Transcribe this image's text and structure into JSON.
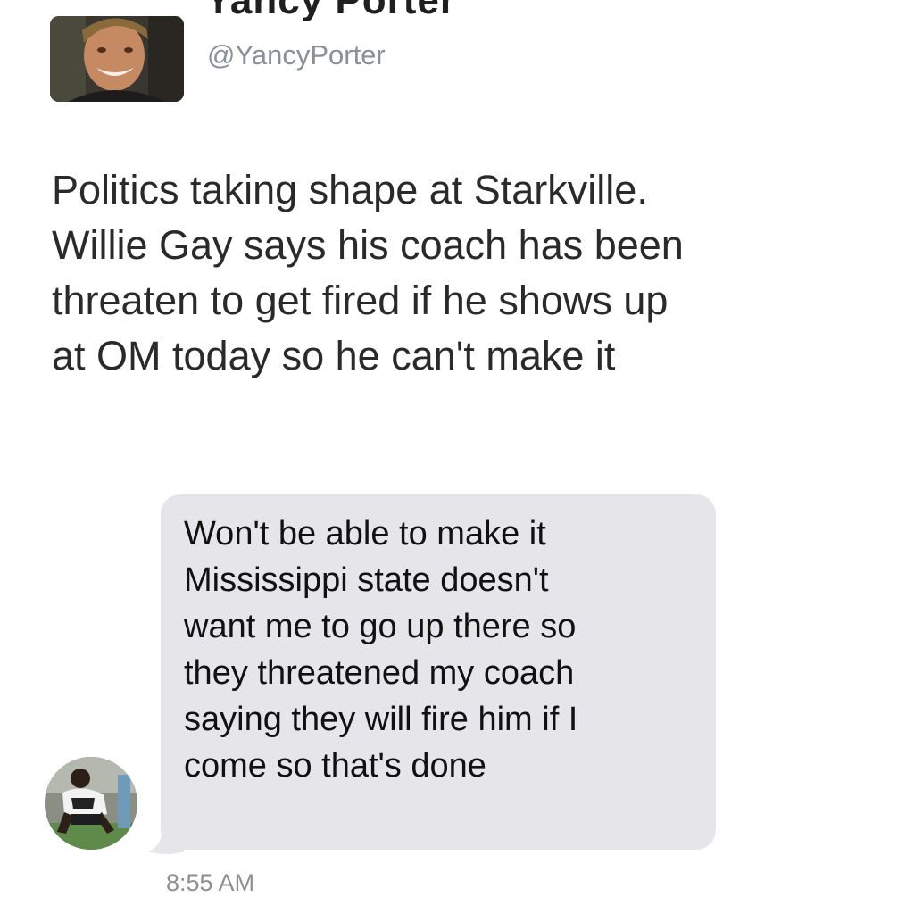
{
  "tweet": {
    "author": {
      "display_name": "Yancy Porter",
      "handle": "@YancyPorter",
      "avatar_icon": "profile-photo-icon"
    },
    "text": "Politics taking shape at Starkville.\nWillie Gay says his coach has been\nthreaten to get fired if he shows up\nat OM today so he can't make it"
  },
  "message": {
    "sender_avatar_icon": "profile-photo-icon",
    "text": "Won't be able to make it\nMississippi state doesn't\nwant me to go up there so\nthey threatened my coach\nsaying they will fire him if I\ncome so that's done",
    "timestamp": "8:55 AM",
    "bubble_color": "#e5e5ea"
  },
  "colors": {
    "handle": "#8a9098",
    "body_text": "#2a2a2a",
    "timestamp": "#8e8e93"
  }
}
